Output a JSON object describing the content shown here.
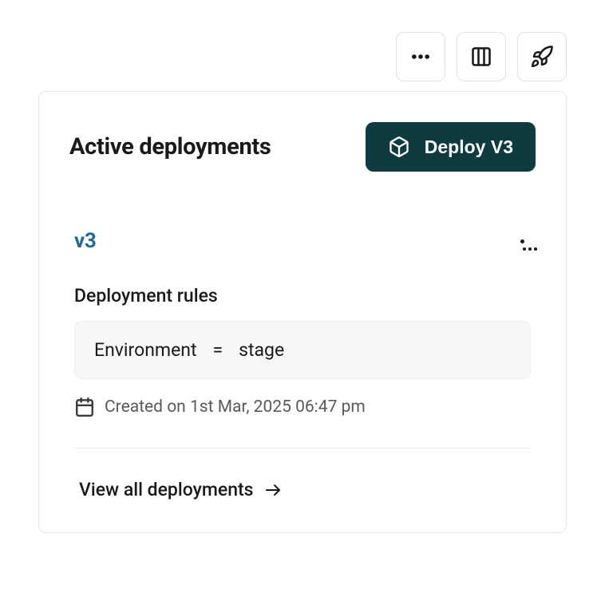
{
  "card": {
    "title": "Active deployments"
  },
  "deploy_button": {
    "label": "Deploy V3"
  },
  "deployment": {
    "version": "v3",
    "rules_label": "Deployment rules",
    "rule": {
      "key": "Environment",
      "operator": "=",
      "value": "stage"
    },
    "created_text": "Created on 1st Mar, 2025 06:47 pm"
  },
  "footer": {
    "view_all_label": "View all deployments"
  }
}
